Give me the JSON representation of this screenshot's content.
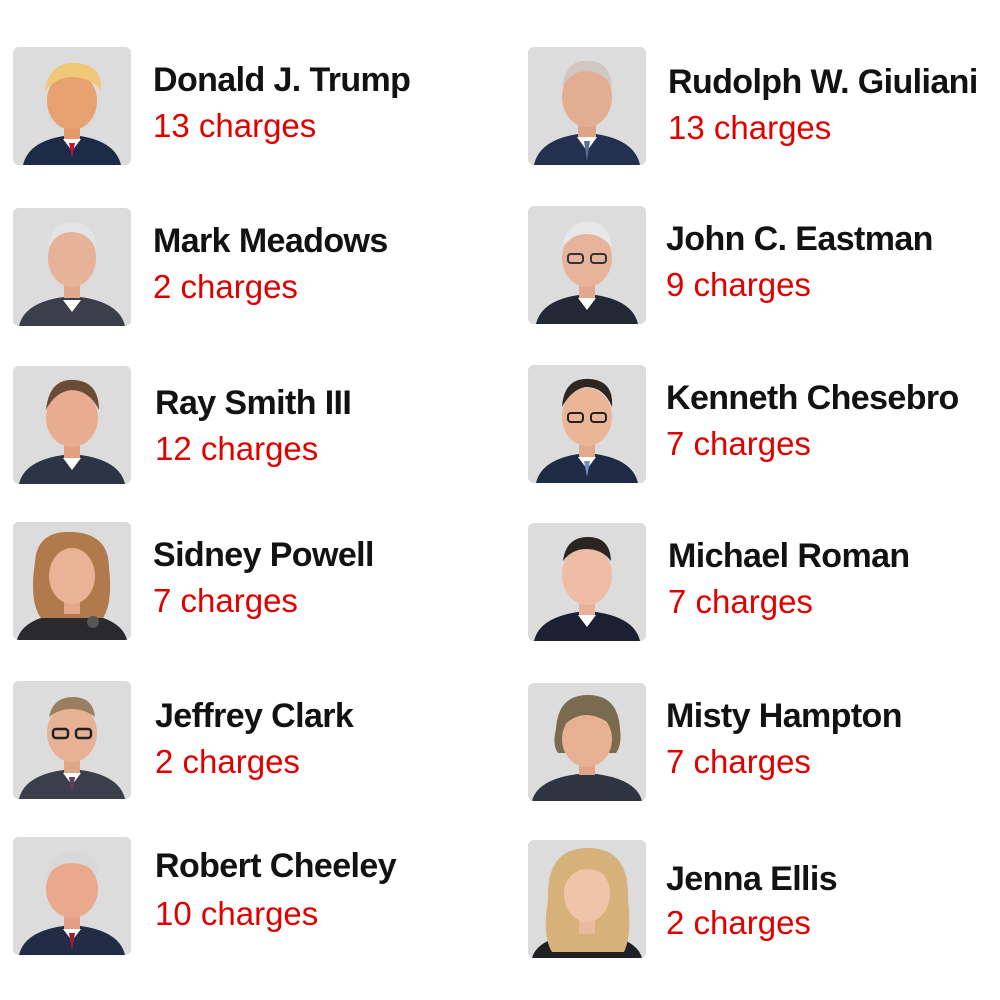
{
  "defendants": [
    {
      "name": "Donald J. Trump",
      "charges": "13 charges",
      "icon": "person-portrait-icon"
    },
    {
      "name": "Rudolph W. Giuliani",
      "charges": "13 charges",
      "icon": "person-portrait-icon"
    },
    {
      "name": "Mark Meadows",
      "charges": "2 charges",
      "icon": "person-portrait-icon"
    },
    {
      "name": "John C. Eastman",
      "charges": "9 charges",
      "icon": "person-portrait-icon"
    },
    {
      "name": "Ray Smith III",
      "charges": "12 charges",
      "icon": "person-portrait-icon"
    },
    {
      "name": "Kenneth Chesebro",
      "charges": "7 charges",
      "icon": "person-portrait-icon"
    },
    {
      "name": "Sidney Powell",
      "charges": "7 charges",
      "icon": "person-portrait-icon"
    },
    {
      "name": "Michael Roman",
      "charges": "7 charges",
      "icon": "person-portrait-icon"
    },
    {
      "name": "Jeffrey Clark",
      "charges": "2 charges",
      "icon": "person-portrait-icon"
    },
    {
      "name": "Misty Hampton",
      "charges": "7 charges",
      "icon": "person-portrait-icon"
    },
    {
      "name": "Robert Cheeley",
      "charges": "10 charges",
      "icon": "person-portrait-icon"
    },
    {
      "name": "Jenna Ellis",
      "charges": "2 charges",
      "icon": "person-portrait-icon"
    }
  ],
  "colors": {
    "name_text": "#121212",
    "charges_text": "#e00000",
    "photo_background": "#dcdcdc"
  }
}
